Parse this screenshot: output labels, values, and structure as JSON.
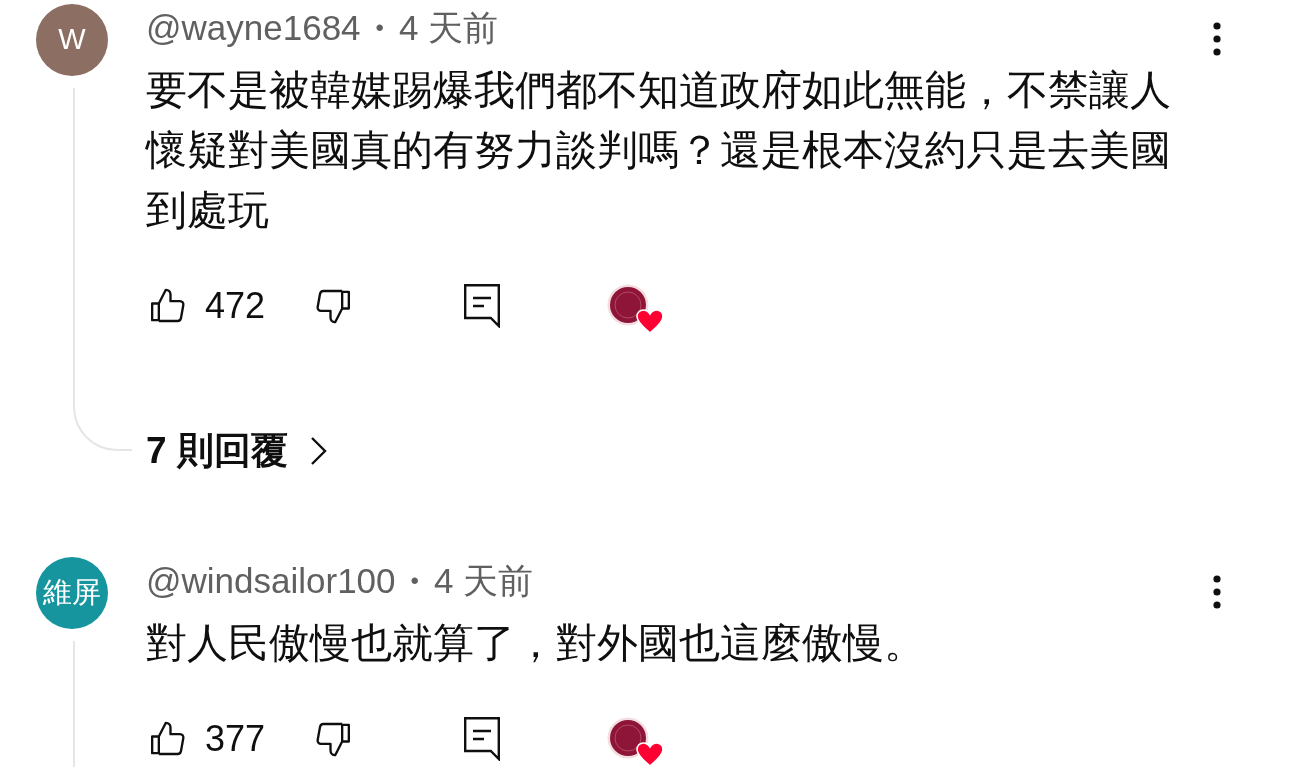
{
  "comments": [
    {
      "avatar": {
        "initial": "W",
        "color": "#8d6e63"
      },
      "author": "@wayne1684",
      "separator": "•",
      "time": "4 天前",
      "text": "要不是被韓媒踢爆我們都不知道政府如此無能，不禁讓人懷疑對美國真的有努力談判嗎？還是根本沒約只是去美國到處玩",
      "likes": "472",
      "creator_hearted": true,
      "has_replies": true,
      "replies": "7 則回覆"
    },
    {
      "avatar": {
        "initial": "維屏",
        "color": "#17959f"
      },
      "author": "@windsailor100",
      "separator": "•",
      "time": "4 天前",
      "text": "對人民傲慢也就算了，對外國也這麼傲慢。",
      "likes": "377",
      "creator_hearted": true,
      "has_replies": true
    }
  ]
}
